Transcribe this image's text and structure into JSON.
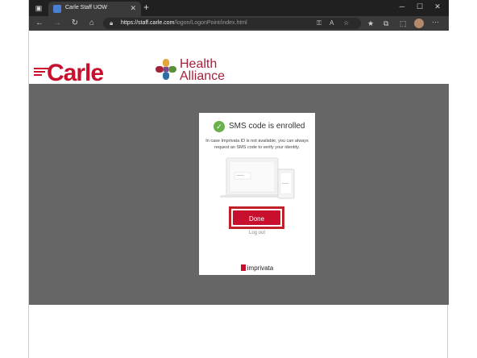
{
  "browser": {
    "tab_title": "Carle Staff UOW",
    "url_host": "https://staff.carle.com",
    "url_path": "/logon/LogonPoint/index.html",
    "new_tab_symbol": "+",
    "tab_close_symbol": "✕"
  },
  "header": {
    "carle_logo": "Carle",
    "health_alliance_line1": "Health",
    "health_alliance_line2": "Alliance"
  },
  "card": {
    "title": "SMS code is enrolled",
    "description": "In case Imprivata ID is not available, you can always request an SMS code to verify your identity.",
    "done_label": "Done",
    "logout_label": "Log out",
    "footer_brand": "imprivata"
  },
  "colors": {
    "brand_red": "#c8102e",
    "success_green": "#6ab04c",
    "overlay_gray": "#666666"
  }
}
